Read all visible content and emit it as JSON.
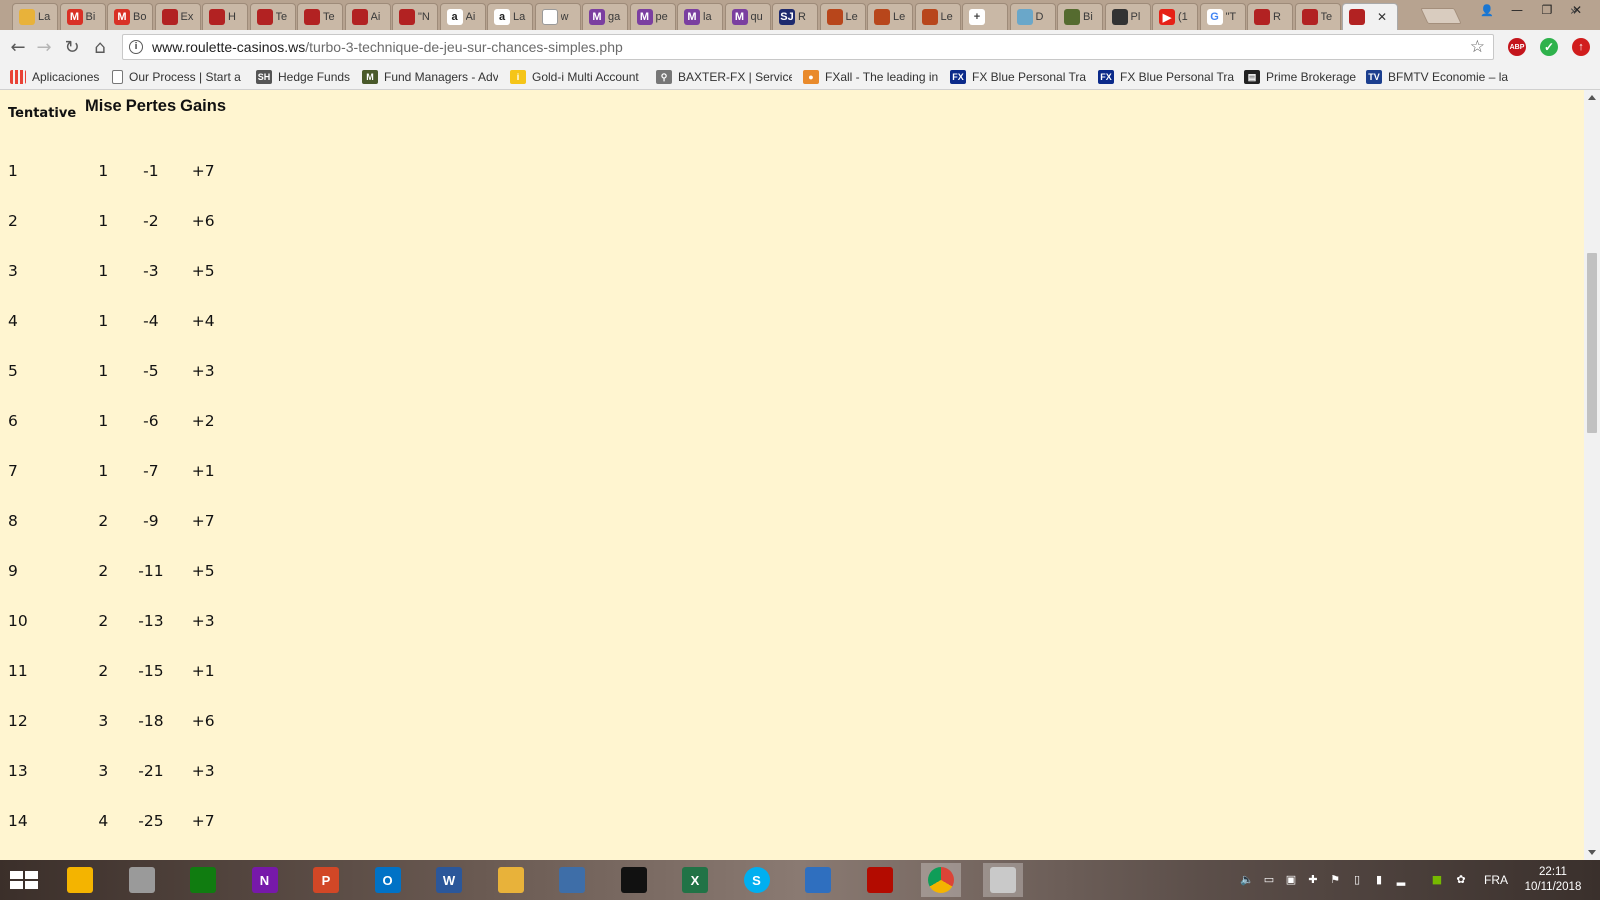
{
  "browser": {
    "tabs": [
      {
        "label": "La",
        "icon": "folder",
        "color": "#e8b23a"
      },
      {
        "label": "Bi",
        "icon": "gmail",
        "color": "#d93025"
      },
      {
        "label": "Bo",
        "icon": "gmail",
        "color": "#d93025"
      },
      {
        "label": "Ex",
        "icon": "roulette",
        "color": "#b22222"
      },
      {
        "label": "H",
        "icon": "roulette",
        "color": "#b22222"
      },
      {
        "label": "Te",
        "icon": "roulette",
        "color": "#b22222"
      },
      {
        "label": "Te",
        "icon": "roulette",
        "color": "#b22222"
      },
      {
        "label": "Ai",
        "icon": "roulette",
        "color": "#b22222"
      },
      {
        "label": "\"N",
        "icon": "roulette",
        "color": "#b22222"
      },
      {
        "label": "Ai",
        "icon": "amazon",
        "color": "#222222"
      },
      {
        "label": "La",
        "icon": "amazon",
        "color": "#222222"
      },
      {
        "label": "w",
        "icon": "page",
        "color": "#9a9a9a"
      },
      {
        "label": "ga",
        "icon": "m",
        "color": "#7b3fa0"
      },
      {
        "label": "pe",
        "icon": "m",
        "color": "#7b3fa0"
      },
      {
        "label": "la",
        "icon": "m",
        "color": "#7b3fa0"
      },
      {
        "label": "qu",
        "icon": "m",
        "color": "#7b3fa0"
      },
      {
        "label": "R",
        "icon": "sj",
        "color": "#1e2a6e"
      },
      {
        "label": "Le",
        "icon": "ball",
        "color": "#b8461b"
      },
      {
        "label": "Le",
        "icon": "ball",
        "color": "#b8461b"
      },
      {
        "label": "Le",
        "icon": "ball",
        "color": "#b8461b"
      },
      {
        "label": "",
        "icon": "plus",
        "color": "#444444"
      },
      {
        "label": "D",
        "icon": "owl",
        "color": "#6aa7c9"
      },
      {
        "label": "Bi",
        "icon": "bull",
        "color": "#556b2f"
      },
      {
        "label": "Pl",
        "icon": "bar",
        "color": "#333333"
      },
      {
        "label": "(1",
        "icon": "youtube",
        "color": "#e62117"
      },
      {
        "label": "\"T",
        "icon": "google",
        "color": "#4285f4"
      },
      {
        "label": "R",
        "icon": "roulette",
        "color": "#b22222"
      },
      {
        "label": "Te",
        "icon": "roulette",
        "color": "#b22222"
      },
      {
        "label": "",
        "icon": "roulette",
        "color": "#b22222",
        "active": true
      }
    ],
    "url": {
      "host": "www.roulette-casinos.ws",
      "path": "/turbo-3-technique-de-jeu-sur-chances-simples.php"
    },
    "bookmarks": [
      {
        "label": "Aplicaciones",
        "icon": "apps-grid"
      },
      {
        "label": "Our Process | Start a",
        "icon": "page"
      },
      {
        "label": "Hedge Funds",
        "icon": "sh"
      },
      {
        "label": "Fund Managers - Adv",
        "icon": "fm"
      },
      {
        "label": "Gold-i Multi Account",
        "icon": "gold"
      },
      {
        "label": "BAXTER-FX | Services",
        "icon": "baxter"
      },
      {
        "label": "FXall - The leading in",
        "icon": "fxall"
      },
      {
        "label": "FX Blue Personal Trac",
        "icon": "fxblue"
      },
      {
        "label": "FX Blue Personal Trac",
        "icon": "fxblue"
      },
      {
        "label": "Prime Brokerage",
        "icon": "pb"
      },
      {
        "label": "BFMTV Economie – la",
        "icon": "bfm"
      }
    ]
  },
  "table": {
    "headers": {
      "tentative": "Tentative",
      "mise": "Mise",
      "pertes": "Pertes",
      "gains": "Gains"
    },
    "rows": [
      {
        "tentative": "1",
        "mise": "1",
        "pertes": "-1",
        "gains": "+7"
      },
      {
        "tentative": "2",
        "mise": "1",
        "pertes": "-2",
        "gains": "+6"
      },
      {
        "tentative": "3",
        "mise": "1",
        "pertes": "-3",
        "gains": "+5"
      },
      {
        "tentative": "4",
        "mise": "1",
        "pertes": "-4",
        "gains": "+4"
      },
      {
        "tentative": "5",
        "mise": "1",
        "pertes": "-5",
        "gains": "+3"
      },
      {
        "tentative": "6",
        "mise": "1",
        "pertes": "-6",
        "gains": "+2"
      },
      {
        "tentative": "7",
        "mise": "1",
        "pertes": "-7",
        "gains": "+1"
      },
      {
        "tentative": "8",
        "mise": "2",
        "pertes": "-9",
        "gains": "+7"
      },
      {
        "tentative": "9",
        "mise": "2",
        "pertes": "-11",
        "gains": "+5"
      },
      {
        "tentative": "10",
        "mise": "2",
        "pertes": "-13",
        "gains": "+3"
      },
      {
        "tentative": "11",
        "mise": "2",
        "pertes": "-15",
        "gains": "+1"
      },
      {
        "tentative": "12",
        "mise": "3",
        "pertes": "-18",
        "gains": "+6"
      },
      {
        "tentative": "13",
        "mise": "3",
        "pertes": "-21",
        "gains": "+3"
      },
      {
        "tentative": "14",
        "mise": "4",
        "pertes": "-25",
        "gains": "+7"
      }
    ]
  },
  "taskbar": {
    "apps": [
      {
        "name": "chrome-canary",
        "label": "",
        "color": "#f4b400"
      },
      {
        "name": "notepad",
        "label": "",
        "color": "#9a9a9a"
      },
      {
        "name": "store",
        "label": "",
        "color": "#107c10"
      },
      {
        "name": "onenote",
        "label": "N",
        "color": "#7719aa"
      },
      {
        "name": "powerpoint",
        "label": "P",
        "color": "#d24726"
      },
      {
        "name": "outlook",
        "label": "O",
        "color": "#0072c6"
      },
      {
        "name": "word",
        "label": "W",
        "color": "#2b579a"
      },
      {
        "name": "explorer",
        "label": "",
        "color": "#e8b23a"
      },
      {
        "name": "owl-app",
        "label": "",
        "color": "#3e6ea8"
      },
      {
        "name": "wolf-app",
        "label": "",
        "color": "#111111"
      },
      {
        "name": "excel",
        "label": "X",
        "color": "#217346"
      },
      {
        "name": "skype",
        "label": "S",
        "color": "#00aff0"
      },
      {
        "name": "network-app",
        "label": "",
        "color": "#2f6fbf"
      },
      {
        "name": "acrobat",
        "label": "",
        "color": "#b30b00"
      },
      {
        "name": "chrome",
        "label": "",
        "color": "#db4437",
        "active": true
      },
      {
        "name": "paint",
        "label": "",
        "color": "#c9c9c9",
        "active": true
      }
    ],
    "language": "FRA",
    "time": "22:11",
    "date": "10/11/2018"
  }
}
